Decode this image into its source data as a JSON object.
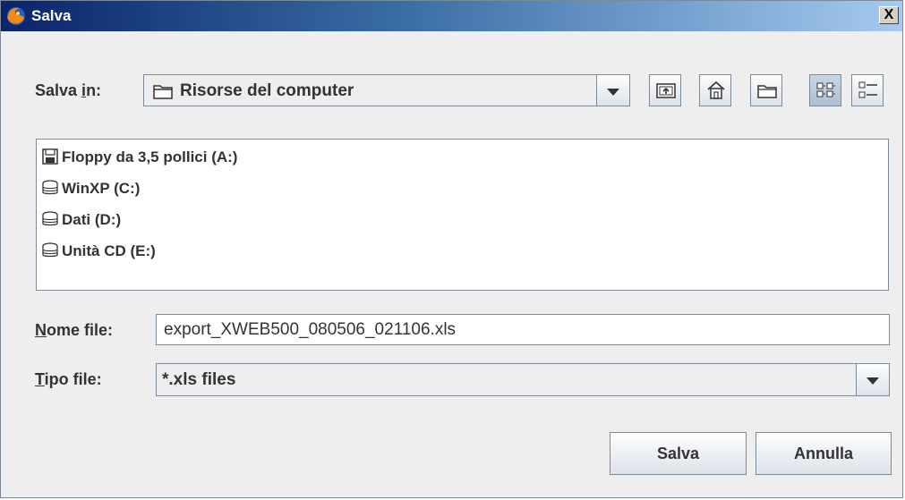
{
  "window": {
    "title": "Salva",
    "close_label": "X"
  },
  "save_in": {
    "label_prefix": "Salva ",
    "label_accel": "i",
    "label_suffix": "n:",
    "value": "Risorse del computer",
    "value_icon": "folder-icon"
  },
  "toolbar": {
    "buttons": [
      {
        "name": "up-one-level",
        "icon": "folder-up-icon"
      },
      {
        "name": "home",
        "icon": "home-icon"
      },
      {
        "name": "new-folder",
        "icon": "new-folder-icon"
      },
      {
        "name": "list-view",
        "icon": "list-view-icon"
      },
      {
        "name": "details-view",
        "icon": "details-view-icon"
      }
    ]
  },
  "files": [
    {
      "label": "Floppy da 3,5 pollici (A:)",
      "icon": "floppy-icon"
    },
    {
      "label": "WinXP (C:)",
      "icon": "hard-drive-icon"
    },
    {
      "label": "Dati (D:)",
      "icon": "hard-drive-icon"
    },
    {
      "label": "Unità CD (E:)",
      "icon": "hard-drive-icon"
    }
  ],
  "filename": {
    "label_accel": "N",
    "label_rest": "ome file:",
    "value": "export_XWEB500_080506_021106.xls"
  },
  "filetype": {
    "label_accel": "T",
    "label_rest": "ipo file:",
    "value": "*.xls files"
  },
  "buttons": {
    "save": "Salva",
    "cancel": "Annulla"
  },
  "colors": {
    "title_start": "#0a246a",
    "title_end": "#a6caf0",
    "panel": "#eeeeee",
    "border": "#7a8a99"
  }
}
